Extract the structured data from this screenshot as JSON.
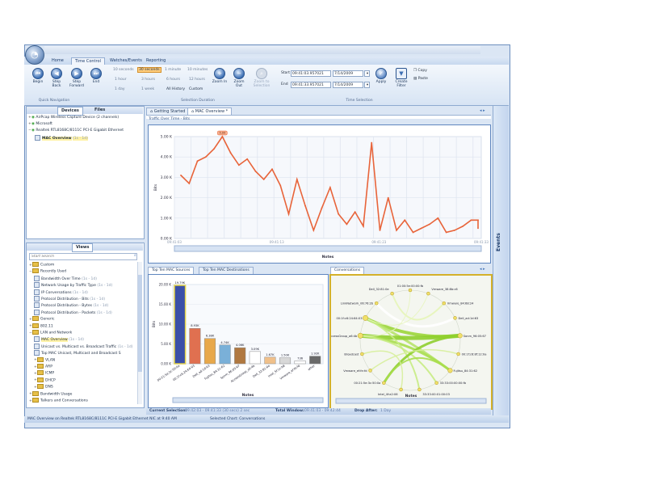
{
  "ribbon": {
    "tabs": [
      "Home",
      "Time Control",
      "Watches/Events",
      "Reporting"
    ],
    "active_tab": "Time Control",
    "nav_buttons": [
      "Begin",
      "Step Back",
      "Step Forward",
      "End"
    ],
    "durations": [
      "10 seconds",
      "30 seconds",
      "1 minute",
      "10 minutes",
      "1 hour",
      "3 hours",
      "6 hours",
      "12 hours",
      "1 day",
      "1 week",
      "All History",
      "Custom"
    ],
    "zoom_buttons": [
      "Zoom In",
      "Zoom Out",
      "Zoom to Selection"
    ],
    "start_label": "Start",
    "end_label": "End",
    "start_time": "09:41:03.957021",
    "start_date": "7/14/2009",
    "end_time": "09:41:33.957021",
    "end_date": "7/14/2009",
    "apply_label": "Apply",
    "create_filter_label": "Create Filter",
    "copy_label": "Copy",
    "paste_label": "Paste",
    "groups": [
      "Quick Navigation",
      "Selection Duration",
      "Time Selection"
    ]
  },
  "devices_panel": {
    "tabs": [
      "Devices",
      "Files"
    ],
    "items": [
      {
        "text": "AirPcap Wireless Capture Device (2 channels)"
      },
      {
        "text": "Microsoft"
      },
      {
        "text": "Realtek RTL8168C/8111C PCI-E Gigabit Ethernet"
      },
      {
        "text": "MAC Overview",
        "extra": "(1s - 1d)"
      }
    ]
  },
  "views_panel": {
    "title": "Views",
    "search_placeholder": "Start Search",
    "items": [
      {
        "text": "Custom",
        "type": "folder",
        "level": 0
      },
      {
        "text": "Recently Used",
        "type": "folder",
        "level": 0
      },
      {
        "text": "Bandwidth Over Time",
        "extra": "(1s - 1d)",
        "type": "doc",
        "level": 1
      },
      {
        "text": "Network Usage by Traffic Type",
        "extra": "(1s - 1d)",
        "type": "doc",
        "level": 1
      },
      {
        "text": "IP Conversations",
        "extra": "(1s - 1d)",
        "type": "doc",
        "level": 1
      },
      {
        "text": "Protocol Distribution - Bits",
        "extra": "(1s - 1d)",
        "type": "doc",
        "level": 1
      },
      {
        "text": "Protocol Distribution - Bytes",
        "extra": "(1s - 1d)",
        "type": "doc",
        "level": 1
      },
      {
        "text": "Protocol Distribution - Packets",
        "extra": "(1s - 1d)",
        "type": "doc",
        "level": 1
      },
      {
        "text": "Generic",
        "type": "folder",
        "level": 0
      },
      {
        "text": "802.11",
        "type": "folder",
        "level": 0
      },
      {
        "text": "LAN and Network",
        "type": "folder",
        "level": 0
      },
      {
        "text": "MAC Overview",
        "extra": "(1s - 1d)",
        "type": "doc",
        "level": 1
      },
      {
        "text": "Unicast vs. Multicast vs. Broadcast Traffic",
        "extra": "(1s - 1d)",
        "type": "doc",
        "level": 1
      },
      {
        "text": "Top MAC Unicast, Multicast and Broadcast S",
        "type": "doc",
        "level": 1
      },
      {
        "text": "VLAN",
        "type": "folder",
        "level": 1
      },
      {
        "text": "ARP",
        "type": "folder",
        "level": 1
      },
      {
        "text": "ICMP",
        "type": "folder",
        "level": 1
      },
      {
        "text": "DHCP",
        "type": "folder",
        "level": 1
      },
      {
        "text": "DNS",
        "type": "folder",
        "level": 1
      },
      {
        "text": "Bandwidth Usage",
        "type": "folder",
        "level": 0
      },
      {
        "text": "Talkers and Conversations",
        "type": "folder",
        "level": 0
      }
    ]
  },
  "doc_tabs": [
    "Getting Started",
    "MAC Overview *"
  ],
  "traffic_chart": {
    "title": "Traffic Over Time - Bits",
    "ylabel": "Bits",
    "xlabel": "Notes",
    "yticks": [
      "0.00 K",
      "1.00 K",
      "2.00 K",
      "3.00 K",
      "4.00 K",
      "5.00 K"
    ],
    "xticks": [
      "09:41:03",
      "09:41:13",
      "09:41:23",
      "09:41:33"
    ],
    "ymax": 5.0,
    "values": [
      3.1,
      2.7,
      3.8,
      4.0,
      4.4,
      5.0,
      4.2,
      3.6,
      3.9,
      3.3,
      2.9,
      3.4,
      2.6,
      1.2,
      2.9,
      1.6,
      0.4,
      1.5,
      2.5,
      1.2,
      0.7,
      1.3,
      0.6,
      4.7,
      0.4,
      2.0,
      0.4,
      0.9,
      0.3,
      0.5,
      0.7,
      1.0,
      0.3,
      0.4,
      0.6,
      0.9,
      0.9,
      0.5
    ],
    "peak_label": "5.00",
    "line_color": "#e8643a"
  },
  "bar_tabs": [
    "Top Ten MAC Sources",
    "Top Ten MAC Destinations"
  ],
  "bar_chart": {
    "ylabel": "Bits",
    "xlabel": "Notes",
    "yticks": [
      "0.00 K",
      "5.00 K",
      "10.00 K",
      "15.00 K",
      "20.00 K"
    ],
    "ymax": 20,
    "values": [
      19.79,
      8.93,
      6.38,
      4.74,
      4.06,
      3.09,
      1.67,
      1.5,
      0.74,
      1.92
    ],
    "value_labels": [
      "19.79K",
      "8.93K",
      "6.38K",
      "4.74K",
      "4.06K",
      "3.09K",
      "1.67K",
      "1.50K",
      "736",
      "1.92K"
    ],
    "categories": [
      "00:21:5e:3c:50:0a",
      "00:1f:c6:24:64:03",
      "Dell_ad:1d:63",
      "Fujitsu_84:31:62",
      "Sonm_96:05:67",
      "AccessGroup_a6:4b",
      "Dell_32:81:0e",
      "Intel_5f:1c:b8",
      "Vmware_ef:fe:fd",
      "other"
    ],
    "colors": [
      "#3a4fa8",
      "#e07050",
      "#e8a84a",
      "#7ab0d8",
      "#b07840",
      "#ffffff",
      "#f0c08a",
      "#d8d8d8",
      "#ffffff",
      "#6a6a6a"
    ]
  },
  "conversations": {
    "title": "Conversations",
    "xlabel": "Notes",
    "nodes": [
      "01:00:5e:00:00:fb",
      "Dell_32:81:0e",
      "LinkNetwork_06:76:2b",
      "00:1f:c6:24:64:03",
      "AccessGroup_a6:4b",
      "Broadcast",
      "Vmware_ef:fe:fd",
      "00:21:5e:3c:50:0a",
      "Intel_4f:a2:06",
      "33:33:00:01:00:03",
      "33:33:00:00:00:fb",
      "Fujitsu_84:31:62",
      "00:1f:c6:8f:12:0a",
      "Sonm_96:05:67",
      "Dell_ad:1d:63",
      "Vmware_84:68:24",
      "Vmware_38:8b:c6"
    ]
  },
  "selection_bar": {
    "current_label": "Current Selection:",
    "current_value": "09:42:03 - 09:41:33 (30 secs) 2 sec",
    "total_label": "Total Window:",
    "total_value": "09:41:03 - 09:42:44",
    "drop_label": "Drop After:",
    "drop_value": "1 Day"
  },
  "status_bar": {
    "left": "MAC Overview on Realtek RTL8168C/8111C PCI-E Gigabit Ethernet NIC at 9:40 AM",
    "right": "Selected Chart: Conversations"
  },
  "events_label": "Events",
  "colors": {
    "accent": "#3d6fb3",
    "frame": "#5f86bf",
    "highlight": "#ffcd7d"
  }
}
